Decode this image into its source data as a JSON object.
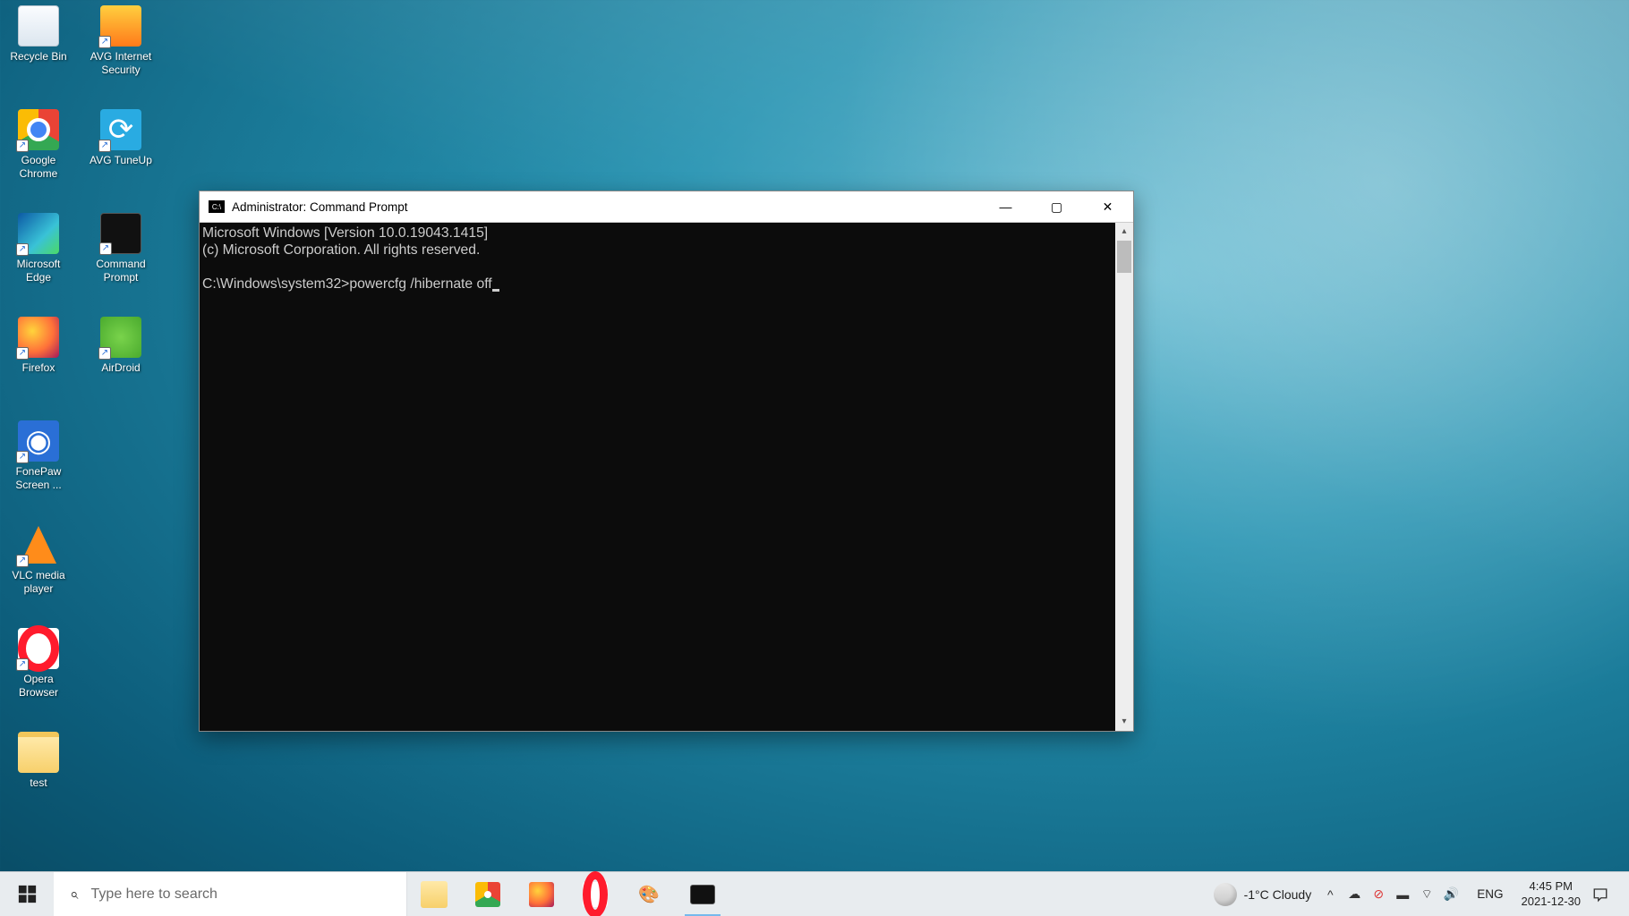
{
  "desktop_icons": {
    "c0": [
      {
        "label": "Recycle Bin"
      },
      {
        "label": "Google Chrome"
      },
      {
        "label": "Microsoft Edge"
      },
      {
        "label": "Firefox"
      },
      {
        "label": "FonePaw Screen ..."
      },
      {
        "label": "VLC media player"
      },
      {
        "label": "Opera Browser"
      },
      {
        "label": "test"
      }
    ],
    "c1": [
      {
        "label": "AVG Internet Security"
      },
      {
        "label": "AVG TuneUp"
      },
      {
        "label": "Command Prompt"
      },
      {
        "label": "AirDroid"
      }
    ]
  },
  "cmd_window": {
    "title": "Administrator: Command Prompt",
    "icon_text": "C:\\",
    "line1": "Microsoft Windows [Version 10.0.19043.1415]",
    "line2": "(c) Microsoft Corporation. All rights reserved.",
    "prompt": "C:\\Windows\\system32>",
    "command": "powercfg /hibernate off"
  },
  "taskbar": {
    "search_placeholder": "Type here to search",
    "weather_text": "-1°C  Cloudy",
    "language": "ENG",
    "time": "4:45 PM",
    "date": "2021-12-30",
    "pinned": [
      "File Explorer",
      "Google Chrome",
      "Firefox",
      "Opera",
      "Paint",
      "Command Prompt"
    ]
  }
}
